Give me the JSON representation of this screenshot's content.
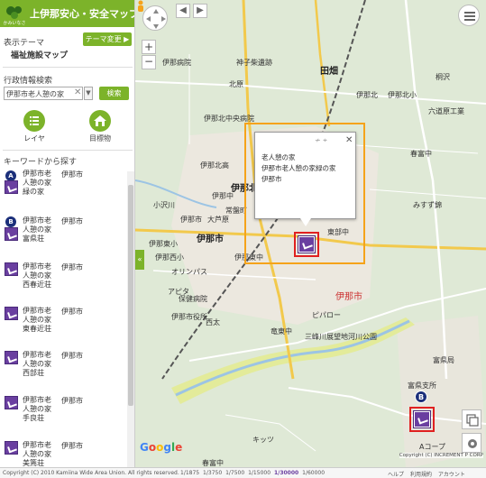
{
  "banner": {
    "title": "上伊那安心・安全マップ",
    "logo_text": "かみいなさんかく"
  },
  "theme": {
    "label": "表示テーマ",
    "change_button": "テーマ変更 ▶",
    "name": "福祉施設マップ"
  },
  "admin_search": {
    "label": "行政情報検索",
    "value": "伊那市老人憩の家",
    "clear": "✕",
    "button": "検索"
  },
  "tools": {
    "layer_label": "レイヤ",
    "landmark_label": "目標物"
  },
  "keyword": {
    "label": "キーワードから探す",
    "items": [
      {
        "pin": "A",
        "name_lines": [
          "伊那市老",
          "人憩の家",
          "緑の家"
        ],
        "city": "伊那市"
      },
      {
        "pin": "B",
        "name_lines": [
          "伊那市老",
          "人憩の家",
          "富県荘"
        ],
        "city": "伊那市"
      },
      {
        "pin": "",
        "name_lines": [
          "伊那市老",
          "人憩の家",
          "西春近荘"
        ],
        "city": "伊那市"
      },
      {
        "pin": "",
        "name_lines": [
          "伊那市老",
          "人憩の家",
          "東春近荘"
        ],
        "city": "伊那市"
      },
      {
        "pin": "",
        "name_lines": [
          "伊那市老",
          "人憩の家",
          "西部荘"
        ],
        "city": "伊那市"
      },
      {
        "pin": "",
        "name_lines": [
          "伊那市老",
          "人憩の家",
          "手良荘"
        ],
        "city": "伊那市"
      },
      {
        "pin": "",
        "name_lines": [
          "伊那市老",
          "人憩の家",
          "美篶荘"
        ],
        "city": "伊那市"
      }
    ]
  },
  "popup": {
    "line1": "老人憩の家",
    "line2": "伊那市老人憩の家緑の家",
    "line3": "伊那市",
    "close": "✕",
    "tools": "≁ ⌖"
  },
  "map": {
    "labels": [
      {
        "text": "伊那病院"
      },
      {
        "text": "神子柴遺跡"
      },
      {
        "text": "田畑"
      },
      {
        "text": "北原"
      },
      {
        "text": "伊那北中央病院"
      },
      {
        "text": "伊那北"
      },
      {
        "text": "伊那北高"
      },
      {
        "text": "小沢川"
      },
      {
        "text": "伊那北"
      },
      {
        "text": "伊那中"
      },
      {
        "text": "伊那市"
      },
      {
        "text": "伊那市"
      },
      {
        "text": "大芦原"
      },
      {
        "text": "常盤町"
      },
      {
        "text": "伊那東小"
      },
      {
        "text": "東部中"
      },
      {
        "text": "伊那西小"
      },
      {
        "text": "伊那東中"
      },
      {
        "text": "オリンパス"
      },
      {
        "text": "アピタ"
      },
      {
        "text": "西太"
      },
      {
        "text": "ピパロー"
      },
      {
        "text": "竜東中"
      },
      {
        "text": "三峰川展望地河川公園"
      },
      {
        "text": "伊那市"
      },
      {
        "text": "富県支所"
      },
      {
        "text": "富県局"
      },
      {
        "text": "Aコープ"
      },
      {
        "text": "春富中"
      },
      {
        "text": "みすず錦"
      },
      {
        "text": "伊那北小"
      },
      {
        "text": "六道原工業"
      },
      {
        "text": "桐沢"
      },
      {
        "text": "伊那市役所"
      },
      {
        "text": "保健病院"
      },
      {
        "text": "キッツ"
      },
      {
        "text": "春富中"
      }
    ],
    "google": "Google",
    "pin_b": "B",
    "copyright_right": "Copyright (C) INCREMENT P CORP",
    "collapse": "«"
  },
  "bottom": {
    "copyright": "Copyright (C) 2010 Kamiina Wide Area Union. All rights reserved.",
    "scales": [
      "1/1875",
      "1/3750",
      "1/7500",
      "1/15000",
      "1/30000",
      "1/60000"
    ],
    "active_scale": "1/30000",
    "links": [
      "ヘルプ",
      "利用規約",
      "アカウント"
    ]
  },
  "colors": {
    "brand": "#7cb32a",
    "facility": "#6a3fa0",
    "highlight": "#f5a31a",
    "select": "#e02020",
    "pin": "#1b2f7a"
  }
}
